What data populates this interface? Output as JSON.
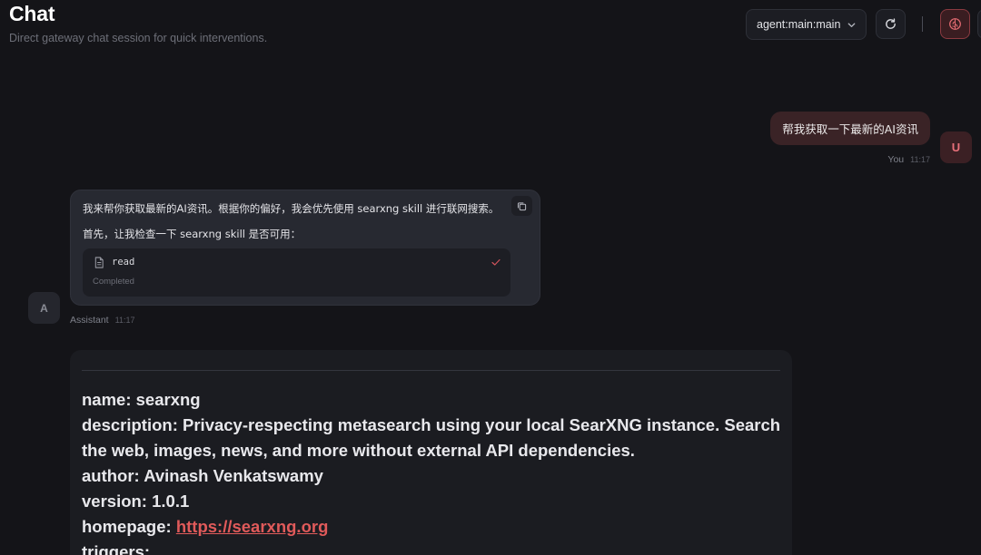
{
  "header": {
    "title": "Chat",
    "subtitle": "Direct gateway chat session for quick interventions.",
    "session_select": {
      "selected": "agent:main:main",
      "icon": "chevron-down-icon"
    },
    "buttons": {
      "refresh_icon": "refresh-icon",
      "focus_icon": "brain-icon"
    }
  },
  "messages": {
    "user": {
      "text": "帮我获取一下最新的AI资讯",
      "avatar": "U",
      "sender": "You",
      "time": "11:17"
    },
    "assistant": {
      "avatar": "A",
      "sender": "Assistant",
      "time": "11:17",
      "lines": [
        "我来帮你获取最新的AI资讯。根据你的偏好，我会优先使用 searxng skill 进行联网搜索。",
        "首先，让我检查一下 searxng skill 是否可用："
      ],
      "tool_call": {
        "name": "read",
        "status": "Completed",
        "icon": "file-icon",
        "status_icon": "check-icon"
      }
    }
  },
  "markdown": {
    "lines": [
      {
        "key": "name:",
        "value": "searxng"
      },
      {
        "key": "description:",
        "value": "Privacy-respecting metasearch using your local SearXNG instance. Search the web, images, news, and more without external API dependencies."
      },
      {
        "key": "author:",
        "value": "Avinash Venkatswamy"
      },
      {
        "key": "version:",
        "value": "1.0.1"
      },
      {
        "key": "homepage:",
        "link": "https://searxng.org"
      },
      {
        "key": "triggers:",
        "value": ""
      }
    ]
  },
  "colors": {
    "background": "#141418",
    "accent": "#e05a5a",
    "user_bubble": "#3a2326",
    "assistant_bubble": "#272931"
  }
}
